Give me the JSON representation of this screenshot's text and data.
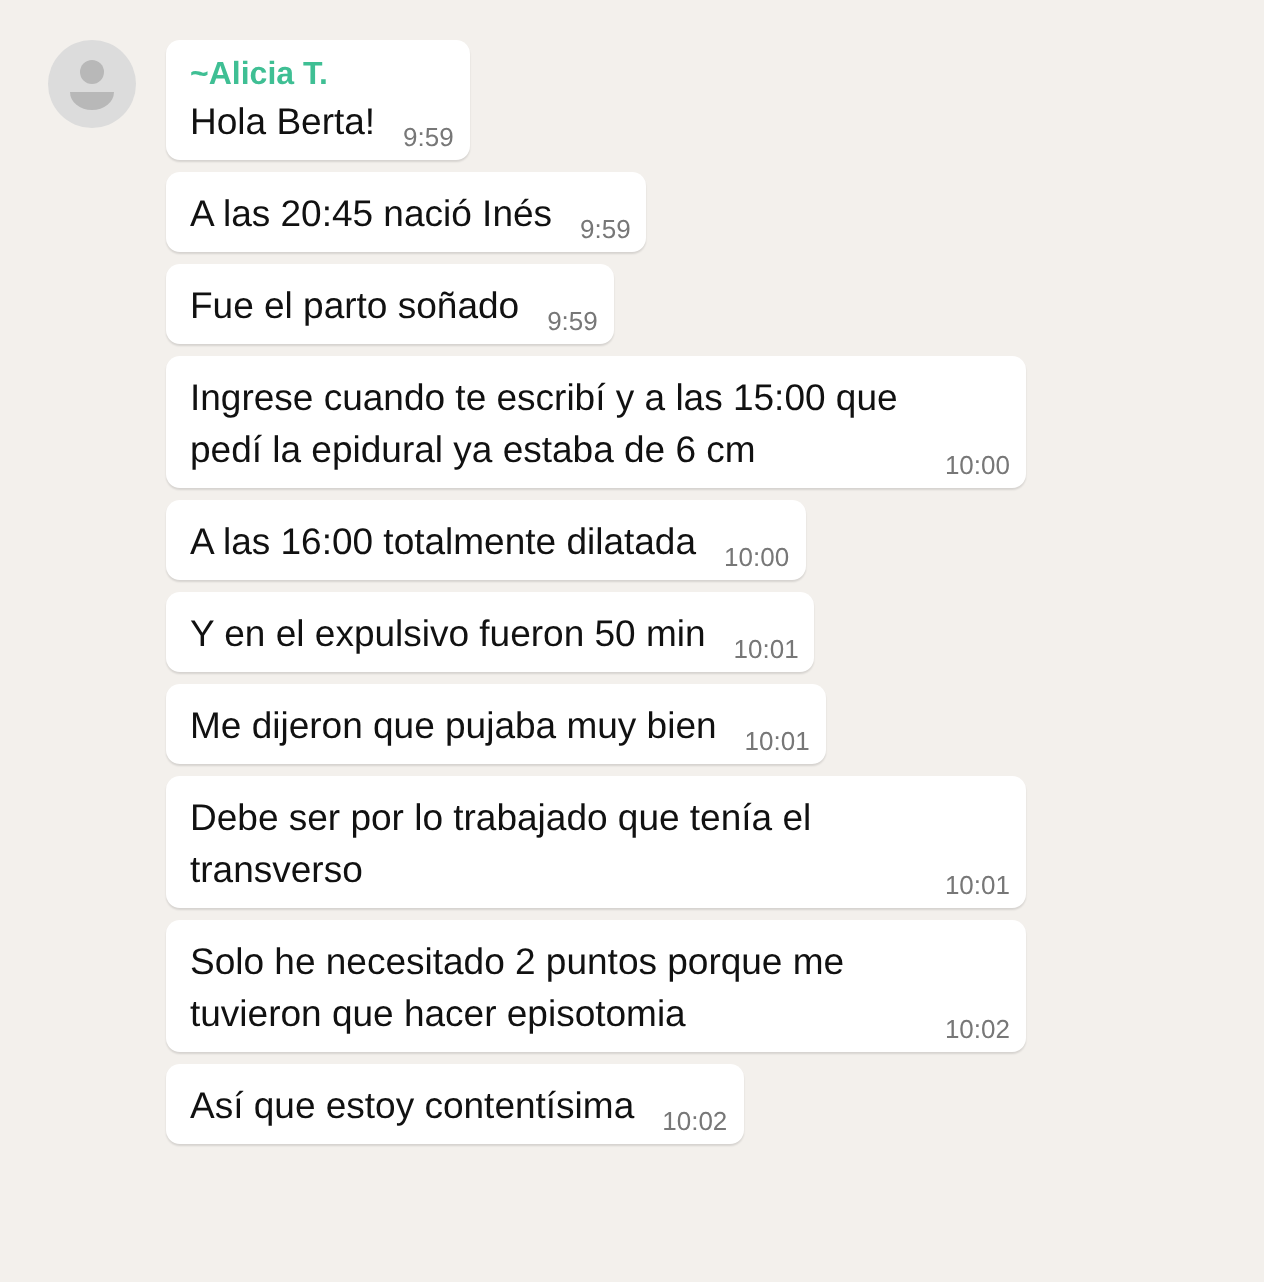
{
  "sender": "~Alicia T.",
  "messages": [
    {
      "text": "Hola Berta!",
      "time": "9:59"
    },
    {
      "text": "A las 20:45 nació Inés",
      "time": "9:59"
    },
    {
      "text": "Fue el parto soñado",
      "time": "9:59"
    },
    {
      "text": "Ingrese cuando te escribí y a las 15:00 que pedí la epidural ya estaba de 6 cm",
      "time": "10:00"
    },
    {
      "text": "A las 16:00 totalmente dilatada",
      "time": "10:00"
    },
    {
      "text": "Y en el expulsivo fueron 50 min",
      "time": "10:01"
    },
    {
      "text": "Me dijeron que pujaba muy bien",
      "time": "10:01"
    },
    {
      "text": "Debe ser por lo trabajado que tenía el transverso",
      "time": "10:01"
    },
    {
      "text": "Solo he necesitado 2 puntos porque me tuvieron que hacer episotomia",
      "time": "10:02"
    },
    {
      "text": "Así que estoy contentísima",
      "time": "10:02"
    }
  ]
}
